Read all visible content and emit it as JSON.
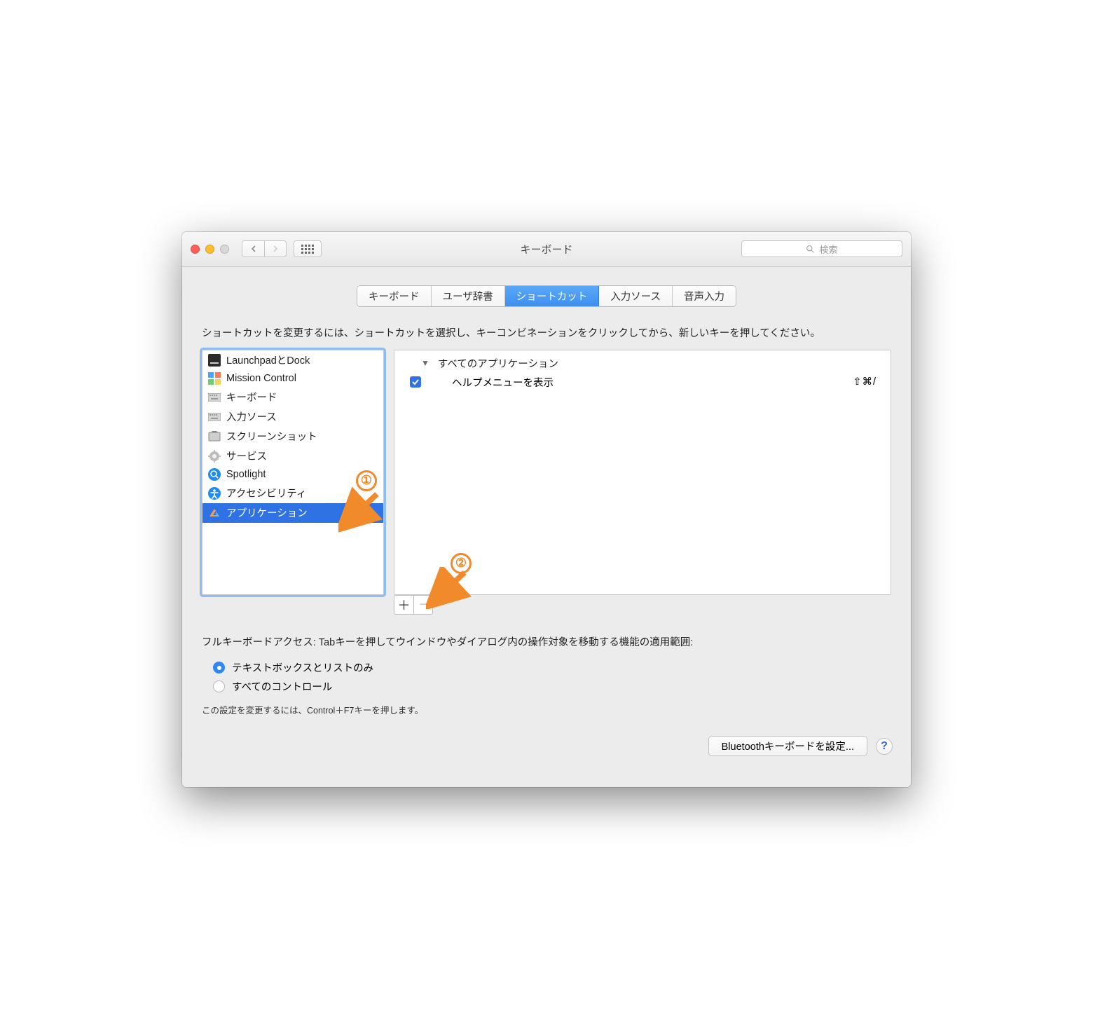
{
  "window": {
    "title": "キーボード"
  },
  "search": {
    "placeholder": "検索"
  },
  "tabs": [
    {
      "label": "キーボード"
    },
    {
      "label": "ユーザ辞書"
    },
    {
      "label": "ショートカット",
      "active": true
    },
    {
      "label": "入力ソース"
    },
    {
      "label": "音声入力"
    }
  ],
  "instructions": "ショートカットを変更するには、ショートカットを選択し、キーコンビネーションをクリックしてから、新しいキーを押してください。",
  "categories": [
    {
      "label": "LaunchpadとDock",
      "icon": "launchpad"
    },
    {
      "label": "Mission Control",
      "icon": "mission"
    },
    {
      "label": "キーボード",
      "icon": "keyboard"
    },
    {
      "label": "入力ソース",
      "icon": "keyboard"
    },
    {
      "label": "スクリーンショット",
      "icon": "screenshot"
    },
    {
      "label": "サービス",
      "icon": "gear"
    },
    {
      "label": "Spotlight",
      "icon": "spotlight"
    },
    {
      "label": "アクセシビリティ",
      "icon": "accessibility"
    },
    {
      "label": "アプリケーション",
      "icon": "app",
      "selected": true
    }
  ],
  "shortcuts": {
    "group_label": "すべてのアプリケーション",
    "items": [
      {
        "checked": true,
        "label": "ヘルプメニューを表示",
        "keys": "⇧⌘/"
      }
    ]
  },
  "fka": {
    "text": "フルキーボードアクセス: Tabキーを押してウインドウやダイアログ内の操作対象を移動する機能の適用範囲:",
    "options": [
      {
        "label": "テキストボックスとリストのみ",
        "checked": true
      },
      {
        "label": "すべてのコントロール",
        "checked": false
      }
    ],
    "hint": "この設定を変更するには、Control＋F7キーを押します。"
  },
  "footer": {
    "bluetooth_label": "Bluetoothキーボードを設定...",
    "help_label": "?"
  },
  "annotations": {
    "one": "①",
    "two": "②"
  }
}
